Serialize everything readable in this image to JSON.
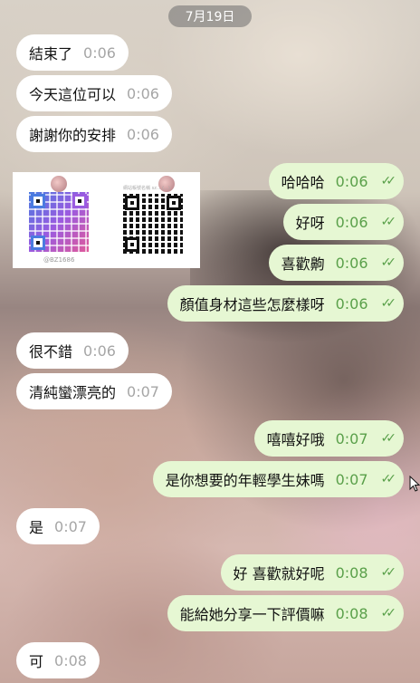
{
  "chat": {
    "date": "7月19日",
    "qr_card": {
      "id_text": "@BZ1686",
      "caption": "網站帳號名稱 sz... (...)"
    },
    "messages": [
      {
        "dir": "in",
        "text": "結束了",
        "time": "0:06"
      },
      {
        "dir": "in",
        "text": "今天這位可以",
        "time": "0:06"
      },
      {
        "dir": "in",
        "text": "謝謝你的安排",
        "time": "0:06"
      },
      {
        "dir": "out",
        "text": "哈哈哈",
        "time": "0:06"
      },
      {
        "dir": "out",
        "text": "好呀",
        "time": "0:06"
      },
      {
        "dir": "out",
        "text": "喜歡齁",
        "time": "0:06"
      },
      {
        "dir": "out",
        "text": "顏值身材這些怎麼樣呀",
        "time": "0:06"
      },
      {
        "dir": "in",
        "text": "很不錯",
        "time": "0:06"
      },
      {
        "dir": "in",
        "text": "清純蠻漂亮的",
        "time": "0:07"
      },
      {
        "dir": "out",
        "text": "嘻嘻好哦",
        "time": "0:07"
      },
      {
        "dir": "out",
        "text": "是你想要的年輕學生妹嗎",
        "time": "0:07"
      },
      {
        "dir": "in",
        "text": "是",
        "time": "0:07"
      },
      {
        "dir": "out",
        "text": "好 喜歡就好呢",
        "time": "0:08"
      },
      {
        "dir": "out",
        "text": "能給她分享一下評價嘛",
        "time": "0:08"
      },
      {
        "dir": "in",
        "text": "可",
        "time": "0:08"
      }
    ]
  },
  "colors": {
    "incoming_bubble": "#ffffff",
    "outgoing_bubble": "#e6f7d3",
    "outgoing_time": "#5aa04a",
    "incoming_time": "#a6a6a6"
  },
  "icons": {
    "read_receipt": "double-check-icon",
    "cursor": "mouse-pointer-icon"
  }
}
